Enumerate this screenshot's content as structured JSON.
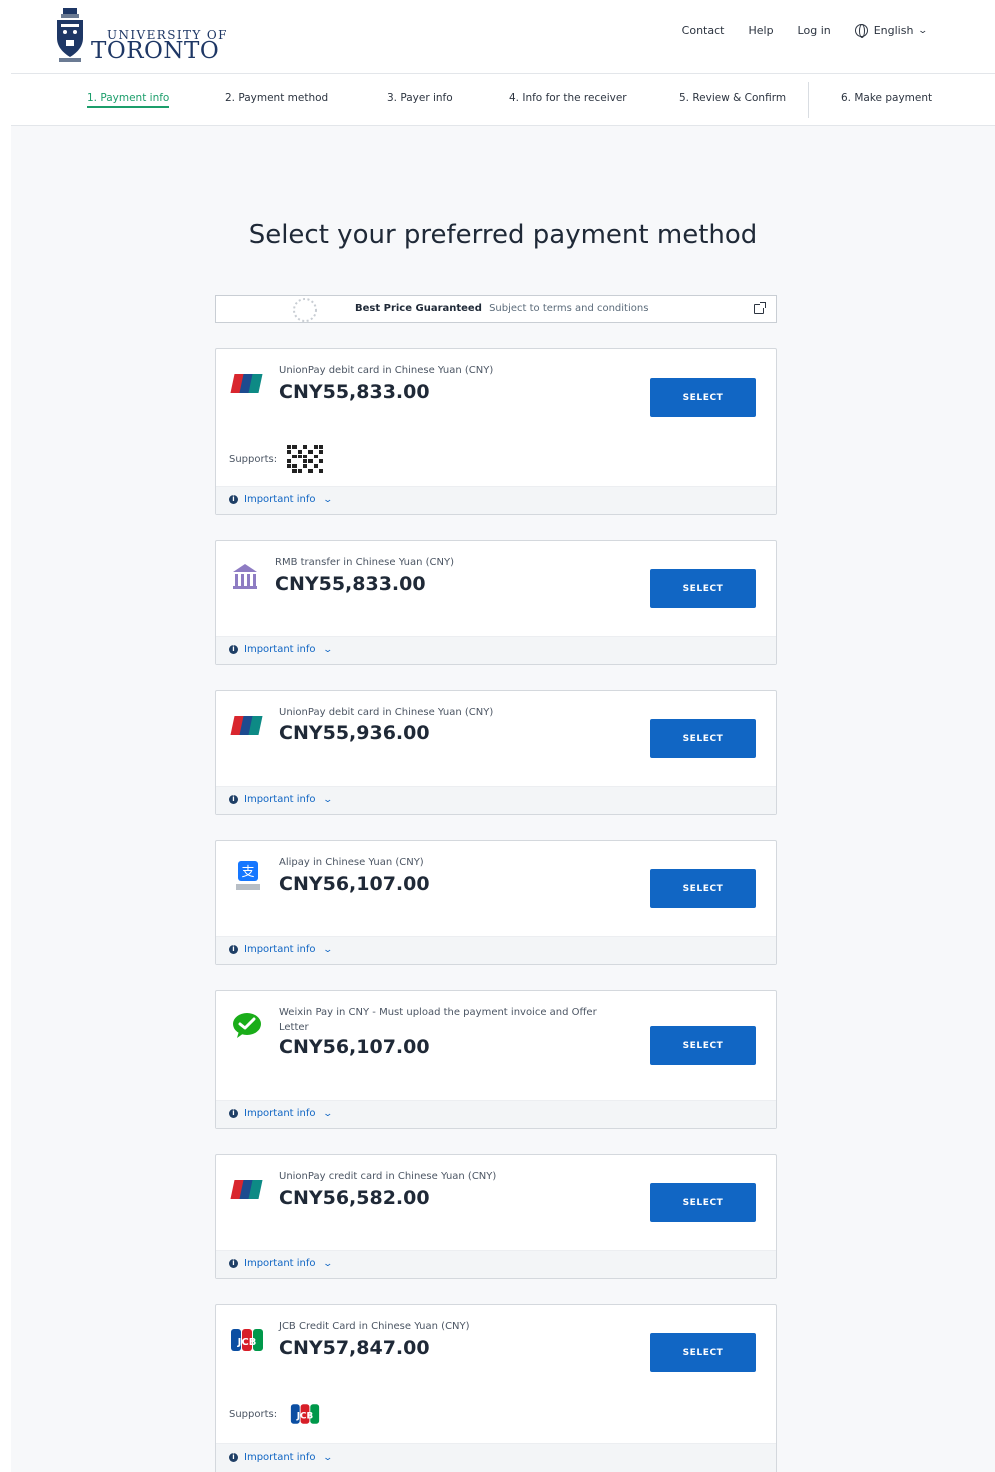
{
  "header": {
    "logo_line1": "UNIVERSITY OF",
    "logo_line2": "TORONTO",
    "nav": {
      "contact": "Contact",
      "help": "Help",
      "login": "Log in",
      "language": "English"
    }
  },
  "steps": [
    {
      "label": "1. Payment info",
      "active": true
    },
    {
      "label": "2. Payment method",
      "active": false
    },
    {
      "label": "3. Payer info",
      "active": false
    },
    {
      "label": "4. Info for the receiver",
      "active": false
    },
    {
      "label": "5. Review & Confirm",
      "active": false
    },
    {
      "label": "6. Make payment",
      "active": false
    }
  ],
  "main": {
    "title": "Select your preferred payment method",
    "banner": {
      "title": "Best Price Guaranteed",
      "subtitle": "Subject to terms and conditions"
    },
    "select_label": "SELECT",
    "info_label": "Important info",
    "supports_label": "Supports:",
    "methods": [
      {
        "icon": "unionpay-icon",
        "label": "UnionPay debit card in Chinese Yuan (CNY)",
        "amount": "CNY55,833.00",
        "supports": "qr-code-icon"
      },
      {
        "icon": "bank-icon",
        "label": "RMB transfer in Chinese Yuan (CNY)",
        "amount": "CNY55,833.00"
      },
      {
        "icon": "unionpay-icon",
        "label": "UnionPay debit card in Chinese Yuan (CNY)",
        "amount": "CNY55,936.00"
      },
      {
        "icon": "alipay-icon",
        "label": "Alipay in Chinese Yuan (CNY)",
        "amount": "CNY56,107.00"
      },
      {
        "icon": "wechat-pay-icon",
        "label": "Weixin Pay in CNY - Must upload the payment invoice and Offer Letter",
        "amount": "CNY56,107.00"
      },
      {
        "icon": "unionpay-icon",
        "label": "UnionPay credit card in Chinese Yuan (CNY)",
        "amount": "CNY56,582.00"
      },
      {
        "icon": "jcb-icon",
        "label": "JCB Credit Card in Chinese Yuan (CNY)",
        "amount": "CNY57,847.00",
        "supports": "jcb-icon"
      }
    ]
  },
  "colors": {
    "primary_button": "#1166c4",
    "active_step": "#1c9e6b",
    "brand_navy": "#1e3765"
  }
}
